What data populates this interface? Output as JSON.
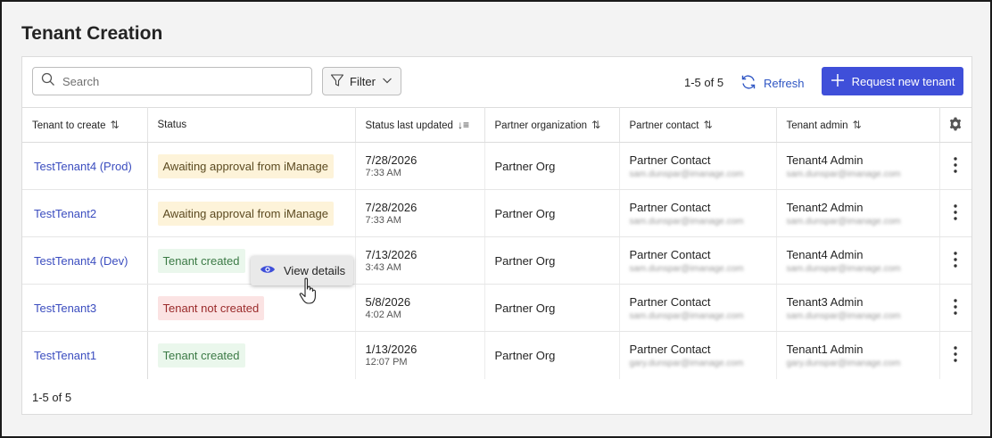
{
  "page": {
    "title": "Tenant Creation"
  },
  "toolbar": {
    "search_placeholder": "Search",
    "filter_label": "Filter",
    "page_count": "1-5 of 5",
    "refresh_label": "Refresh",
    "request_label": "Request new tenant"
  },
  "table": {
    "headers": {
      "tenant": "Tenant to create",
      "status": "Status",
      "updated": "Status last updated",
      "org": "Partner organization",
      "contact": "Partner contact",
      "admin": "Tenant admin"
    },
    "rows": [
      {
        "tenant": "TestTenant4 (Prod)",
        "status": "Awaiting approval from iManage",
        "date": "7/28/2026",
        "time": "7:33 AM",
        "org": "Partner Org",
        "contact": "Partner Contact",
        "contact_email": "sam.dunspar@imanage.com",
        "admin": "Tenant4 Admin",
        "admin_email": "sam.dunspar@imanage.com"
      },
      {
        "tenant": "TestTenant2",
        "status": "Awaiting approval from iManage",
        "date": "7/28/2026",
        "time": "7:33 AM",
        "org": "Partner Org",
        "contact": "Partner Contact",
        "contact_email": "sam.dunspar@imanage.com",
        "admin": "Tenant2 Admin",
        "admin_email": "sam.dunspar@imanage.com"
      },
      {
        "tenant": "TestTenant4 (Dev)",
        "status": "Tenant created",
        "date": "7/13/2026",
        "time": "3:43 AM",
        "org": "Partner Org",
        "contact": "Partner Contact",
        "contact_email": "sam.dunspar@imanage.com",
        "admin": "Tenant4 Admin",
        "admin_email": "sam.dunspar@imanage.com"
      },
      {
        "tenant": "TestTenant3",
        "status": "Tenant not created",
        "date": "5/8/2026",
        "time": "4:02 AM",
        "org": "Partner Org",
        "contact": "Partner Contact",
        "contact_email": "sam.dunspar@imanage.com",
        "admin": "Tenant3 Admin",
        "admin_email": "sam.dunspar@imanage.com"
      },
      {
        "tenant": "TestTenant1",
        "status": "Tenant created",
        "date": "1/13/2026",
        "time": "12:07 PM",
        "org": "Partner Org",
        "contact": "Partner Contact",
        "contact_email": "gary.dunspar@imanage.com",
        "admin": "Tenant1 Admin",
        "admin_email": "gary.dunspar@imanage.com"
      }
    ]
  },
  "footer": {
    "page_count": "1-5 of 5"
  },
  "tooltip": {
    "label": "View details"
  },
  "colors": {
    "accent": "#3f4fd9",
    "link": "#3b4dbf"
  }
}
